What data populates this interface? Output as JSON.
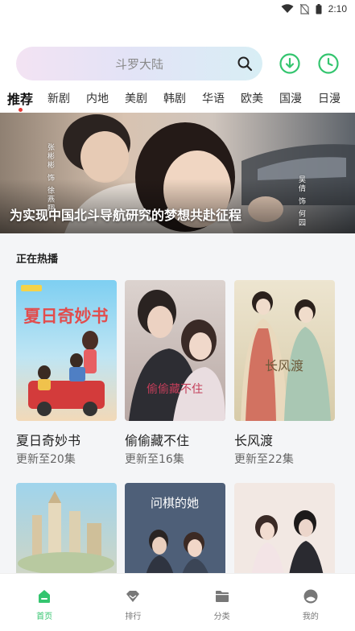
{
  "status": {
    "time": "2:10",
    "icons": [
      "wifi-icon",
      "no-sim-icon",
      "battery-icon"
    ]
  },
  "search": {
    "placeholder": "斗罗大陆"
  },
  "tabs": [
    {
      "label": "推荐",
      "active": true
    },
    {
      "label": "新剧"
    },
    {
      "label": "内地"
    },
    {
      "label": "美剧"
    },
    {
      "label": "韩剧"
    },
    {
      "label": "华语"
    },
    {
      "label": "欧美"
    },
    {
      "label": "国漫"
    },
    {
      "label": "日漫"
    }
  ],
  "banner": {
    "caption": "为实现中国北斗导航研究的梦想共赴征程",
    "credits_left": [
      "张彬彬",
      "饰",
      "徐燕翔"
    ],
    "credits_right": [
      "吴倩",
      "饰",
      "何园"
    ]
  },
  "section": {
    "title": "正在热播"
  },
  "cards": [
    {
      "title": "夏日奇妙书",
      "subtitle": "更新至20集",
      "poster_text": "夏日奇妙书"
    },
    {
      "title": "偷偷藏不住",
      "subtitle": "更新至16集",
      "poster_text": "偷偷藏不住"
    },
    {
      "title": "长风渡",
      "subtitle": "更新至22集",
      "poster_text": "长风渡"
    },
    {
      "title": "",
      "subtitle": "",
      "poster_text": ""
    },
    {
      "title": "",
      "subtitle": "",
      "poster_text": "问棋的她"
    },
    {
      "title": "",
      "subtitle": "",
      "poster_text": ""
    }
  ],
  "bottom_nav": [
    {
      "label": "首页",
      "icon": "home-icon",
      "active": true
    },
    {
      "label": "排行",
      "icon": "diamond-icon"
    },
    {
      "label": "分类",
      "icon": "folder-icon"
    },
    {
      "label": "我的",
      "icon": "profile-icon"
    }
  ],
  "colors": {
    "accent": "#34c56f",
    "active_dot": "#e53935"
  }
}
